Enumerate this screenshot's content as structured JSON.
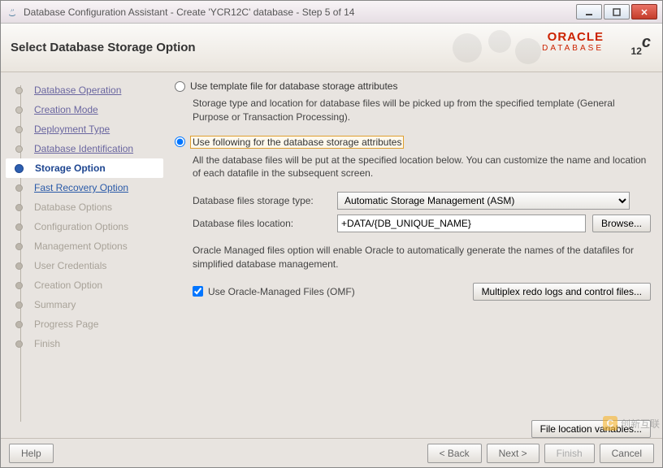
{
  "window": {
    "title": "Database Configuration Assistant - Create 'YCR12C' database - Step 5 of 14"
  },
  "header": {
    "title": "Select Database Storage Option",
    "brand_primary": "ORACLE",
    "brand_secondary": "DATABASE",
    "brand_version_num": "12",
    "brand_version_suffix": "c"
  },
  "sidebar": {
    "steps": [
      {
        "label": "Database Operation",
        "state": "done"
      },
      {
        "label": "Creation Mode",
        "state": "done"
      },
      {
        "label": "Deployment Type",
        "state": "done"
      },
      {
        "label": "Database Identification",
        "state": "done"
      },
      {
        "label": "Storage Option",
        "state": "active"
      },
      {
        "label": "Fast Recovery Option",
        "state": "next"
      },
      {
        "label": "Database Options",
        "state": "future"
      },
      {
        "label": "Configuration Options",
        "state": "future"
      },
      {
        "label": "Management Options",
        "state": "future"
      },
      {
        "label": "User Credentials",
        "state": "future"
      },
      {
        "label": "Creation Option",
        "state": "future"
      },
      {
        "label": "Summary",
        "state": "future"
      },
      {
        "label": "Progress Page",
        "state": "future"
      },
      {
        "label": "Finish",
        "state": "future"
      }
    ]
  },
  "main": {
    "opt1": {
      "label": "Use template file for database storage attributes",
      "desc": "Storage type and location for database files will be picked up from the specified template (General Purpose or Transaction Processing).",
      "selected": false
    },
    "opt2": {
      "label": "Use following for the database storage attributes",
      "desc": "All the database files will be put at the specified location below. You can customize the name and location of each datafile in the subsequent screen.",
      "selected": true
    },
    "storage_type_label": "Database files storage type:",
    "storage_type_value": "Automatic Storage Management (ASM)",
    "location_label": "Database files location:",
    "location_value": "+DATA/{DB_UNIQUE_NAME}",
    "browse_btn": "Browse...",
    "omf_desc": "Oracle Managed files option will enable Oracle to automatically generate the names of the datafiles for simplified database management.",
    "omf_label": "Use Oracle-Managed Files (OMF)",
    "omf_checked": true,
    "multiplex_btn": "Multiplex redo logs and control files...",
    "file_loc_btn": "File location variables..."
  },
  "footer": {
    "help": "Help",
    "back": "< Back",
    "next": "Next >",
    "finish": "Finish",
    "cancel": "Cancel"
  },
  "watermark": "创新互联"
}
